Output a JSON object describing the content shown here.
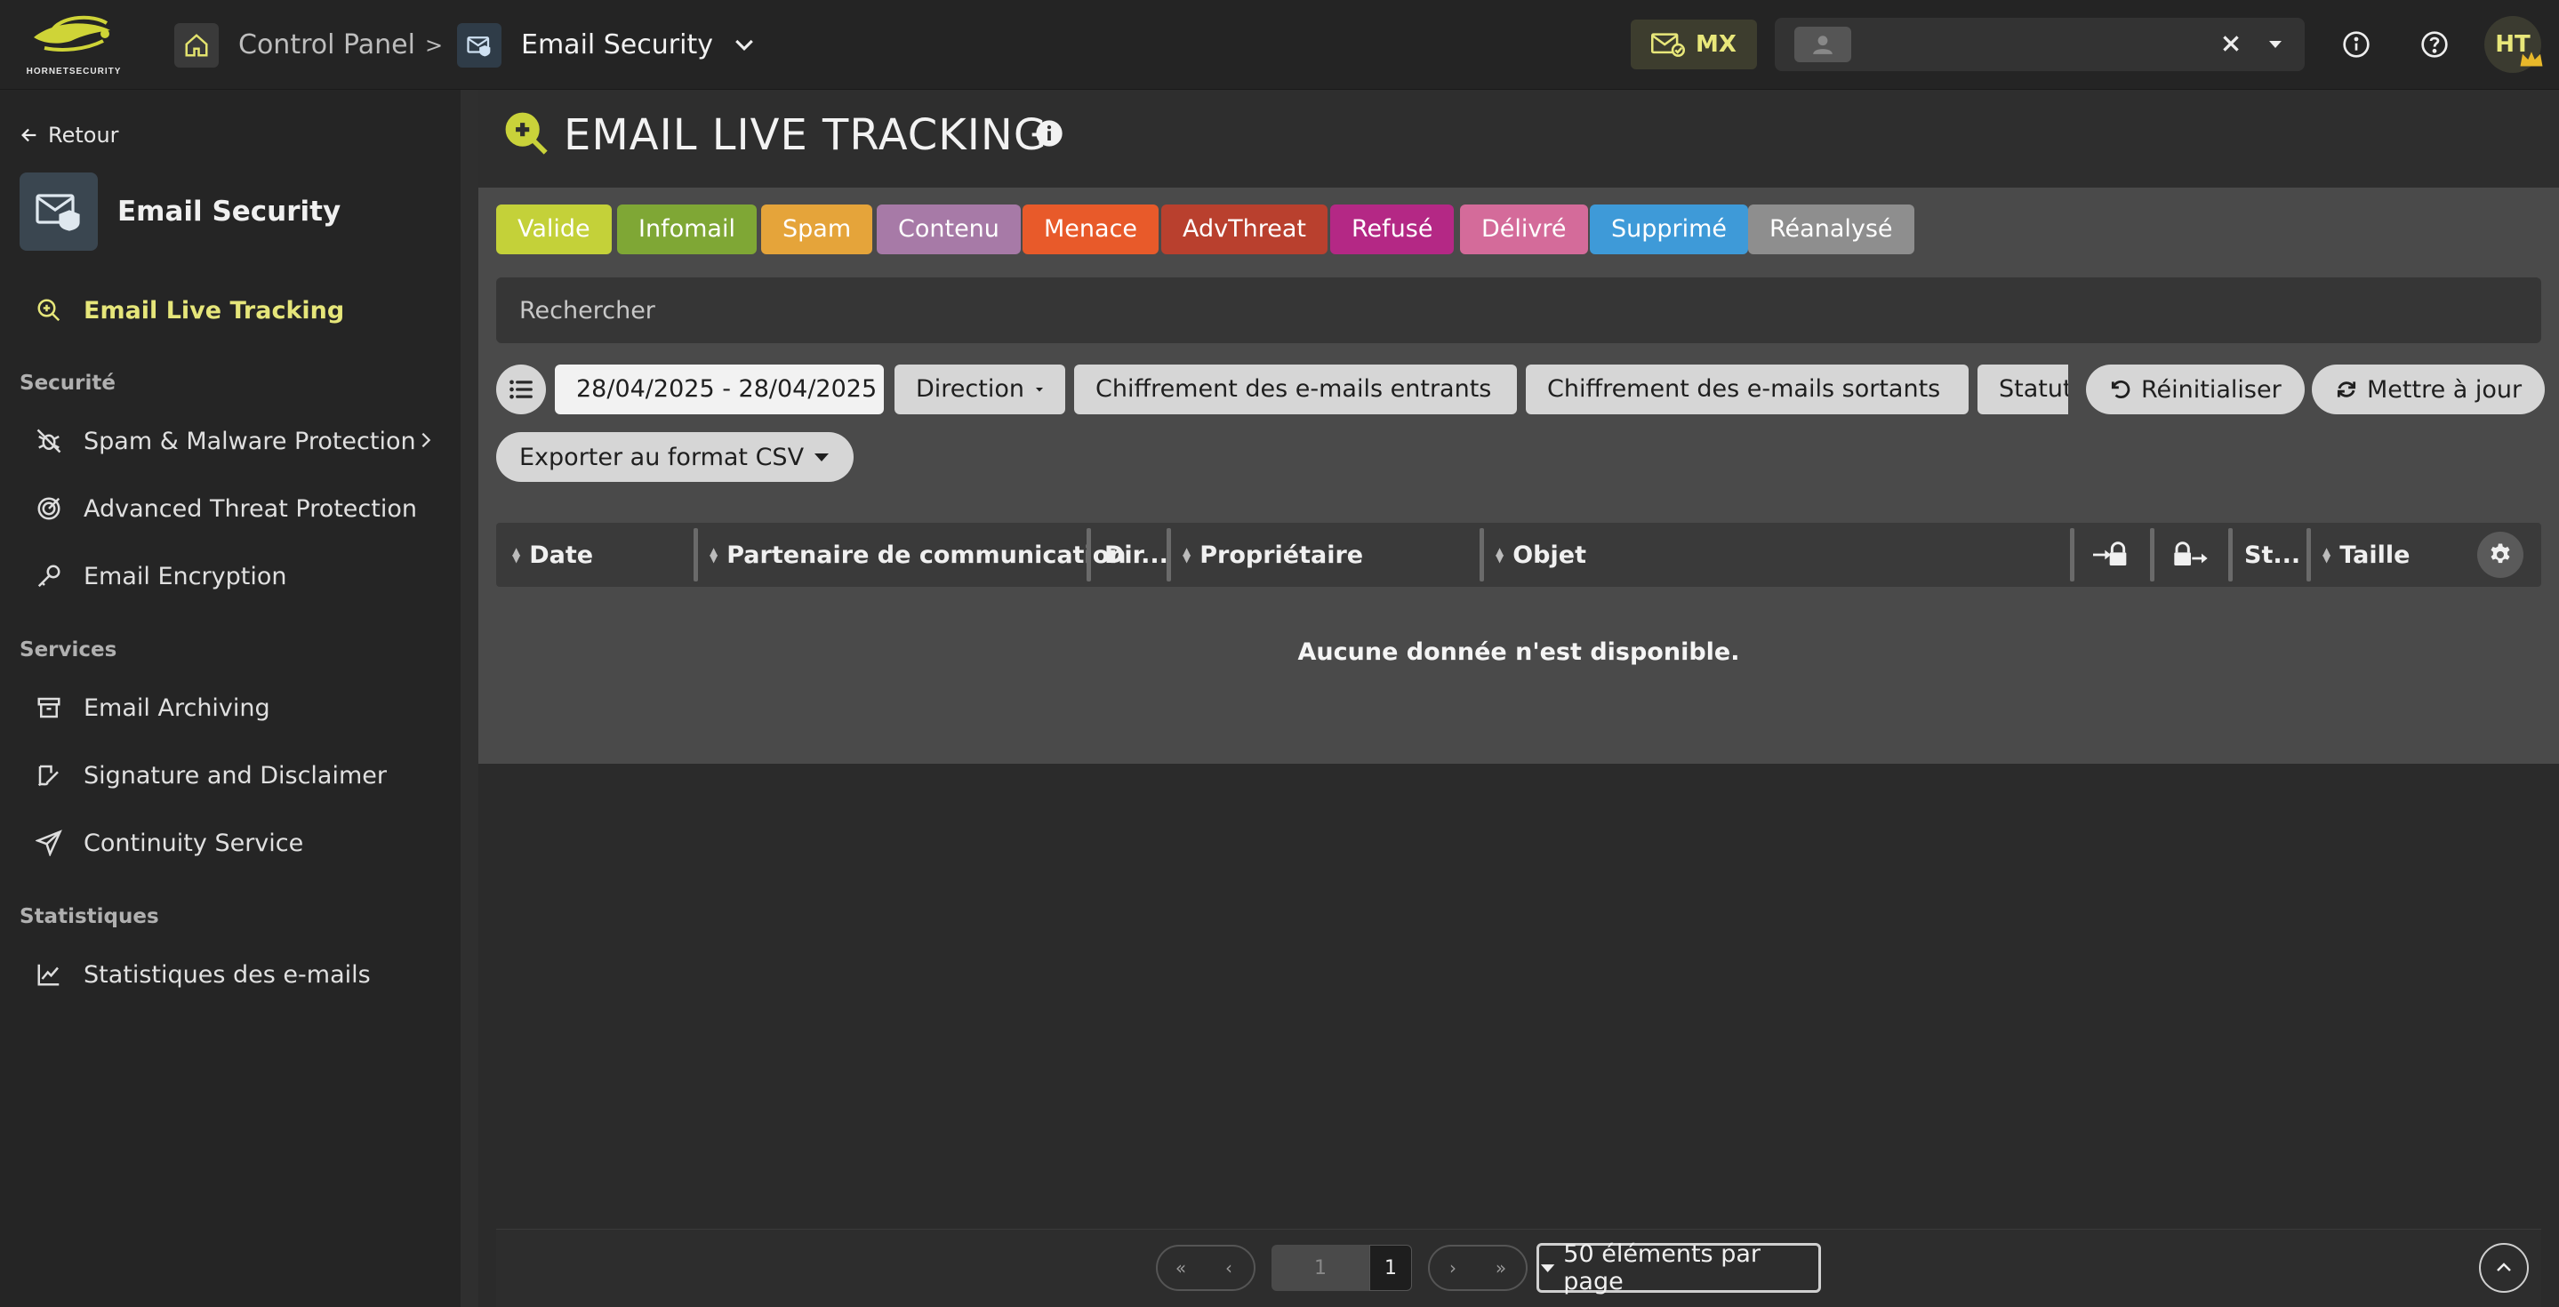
{
  "topbar": {
    "logo_text": "HORNETSECURITY",
    "breadcrumb": {
      "control_panel": "Control Panel",
      "separator": ">",
      "module": "Email Security"
    },
    "mx_label": "MX",
    "user_initials": "HT"
  },
  "sidebar": {
    "back": "Retour",
    "module_title": "Email Security",
    "active_item": "Email Live Tracking",
    "sections": [
      {
        "title": "Securité",
        "items": [
          "Spam & Malware Protection",
          "Advanced Threat Protection",
          "Email Encryption"
        ]
      },
      {
        "title": "Services",
        "items": [
          "Email Archiving",
          "Signature and Disclaimer",
          "Continuity Service"
        ]
      },
      {
        "title": "Statistiques",
        "items": [
          "Statistiques des e-mails"
        ]
      }
    ]
  },
  "page": {
    "title": "EMAIL LIVE TRACKING",
    "chips": [
      {
        "label": "Valide",
        "color": "#c4d139"
      },
      {
        "label": "Infomail",
        "color": "#7fa735"
      },
      {
        "label": "Spam",
        "color": "#e5a43a"
      },
      {
        "label": "Contenu",
        "color": "#a77aa7"
      },
      {
        "label": "Menace",
        "color": "#e85a2a"
      },
      {
        "label": "AdvThreat",
        "color": "#b9402e"
      },
      {
        "label": "Refusé",
        "color": "#b42885"
      },
      {
        "label": "Délivré",
        "color": "#d46b9a"
      },
      {
        "label": "Supprimé",
        "color": "#3e9ad8"
      },
      {
        "label": "Réanalysé",
        "color": "#8e8e8e"
      }
    ],
    "search_placeholder": "Rechercher",
    "filters": {
      "date_range": "28/04/2025 - 28/04/2025",
      "direction": "Direction",
      "incoming_encryption": "Chiffrement des e-mails entrants",
      "outgoing_encryption": "Chiffrement des e-mails sortants",
      "status": "Statut",
      "reset": "Réinitialiser",
      "refresh": "Mettre à jour",
      "export": "Exporter au format CSV"
    },
    "table": {
      "columns": [
        "Date",
        "Partenaire de communication",
        "Dir...",
        "Propriétaire",
        "Objet",
        "St...",
        "Taille"
      ],
      "empty_message": "Aucune donnée n'est disponible."
    },
    "pagination": {
      "current_page": "1",
      "total_pages": "1",
      "per_page": "50 éléments par page"
    }
  }
}
